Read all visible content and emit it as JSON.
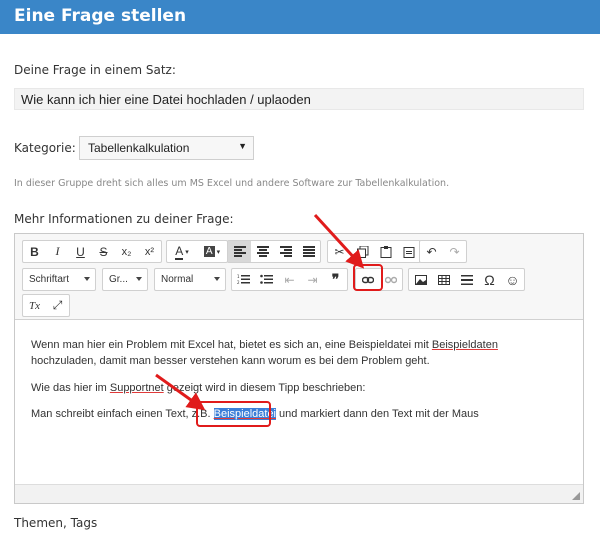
{
  "header": {
    "title": "Eine Frage stellen"
  },
  "question": {
    "label": "Deine Frage in einem Satz:",
    "value": "Wie kann ich hier eine Datei hochladen / uplaoden"
  },
  "category": {
    "label": "Kategorie:",
    "selected": "Tabellenkalkulation",
    "hint": "In dieser Gruppe dreht sich alles um MS Excel und andere Software zur Tabellenkalkulation."
  },
  "details": {
    "label": "Mehr Informationen zu deiner Frage:"
  },
  "toolbar": {
    "row1": {
      "bold": "B",
      "italic": "I",
      "underline": "U",
      "strike": "S",
      "subscript": "x₂",
      "superscript": "x²",
      "font_color": "A",
      "bg_color": "A"
    },
    "row2": {
      "font": "Schriftart",
      "size": "Gr...",
      "format": "Normal",
      "quote": "❞",
      "special_char": "Ω",
      "emoji": "☺"
    },
    "row3": {
      "remove_format": "Tx"
    }
  },
  "editor_content": {
    "p1_a": "Wenn man hier ein Problem mit Excel hat, bietet es sich an, eine Beispieldatei mit ",
    "p1_b": "Beispieldaten",
    "p1_c": " hochzuladen, damit man besser verstehen kann worum es bei dem Problem geht.",
    "p2_a": "Wie das hier im ",
    "p2_b": "Supportnet",
    "p2_c": " gezeigt wird in diesem Tipp beschrieben:",
    "p3_a": "Man schreibt einfach einen Text, z.B. ",
    "p3_b": "Beispieldatei",
    "p3_c": " und markiert dann den Text mit der Maus"
  },
  "tags": {
    "label": "Themen, Tags"
  },
  "colors": {
    "header": "#3a86c8",
    "highlight": "#e01b1b",
    "selection": "#3b7fd8"
  }
}
